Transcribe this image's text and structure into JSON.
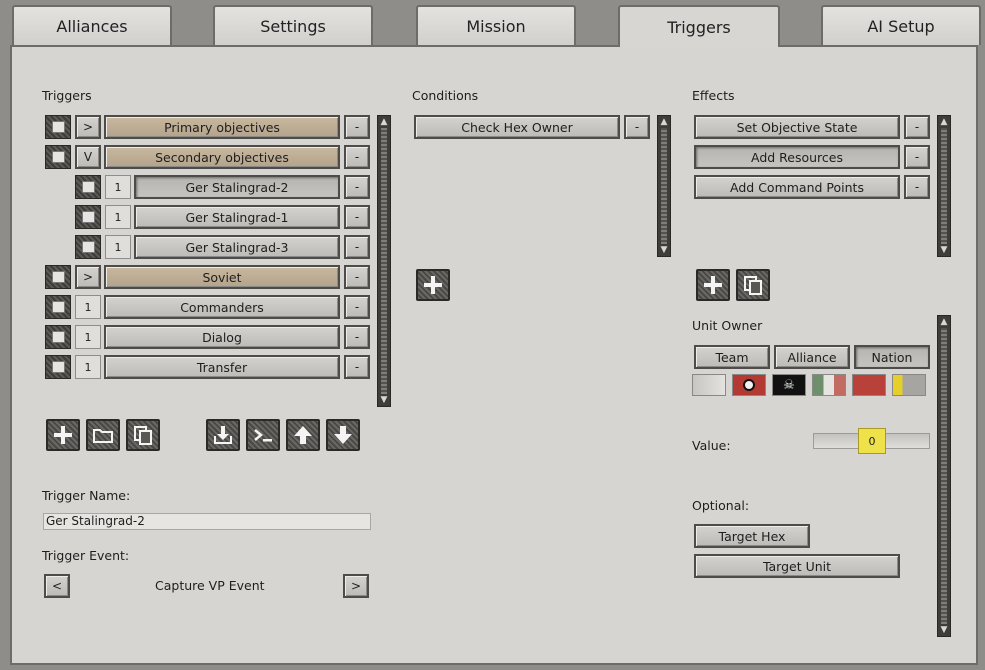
{
  "tabs": [
    {
      "label": "Alliances"
    },
    {
      "label": "Settings"
    },
    {
      "label": "Mission"
    },
    {
      "label": "Triggers"
    },
    {
      "label": "AI Setup"
    }
  ],
  "active_tab": "Triggers",
  "triggers": {
    "heading": "Triggers",
    "items": [
      {
        "toggle": ">",
        "label": "Primary objectives"
      },
      {
        "toggle": "V",
        "label": "Secondary objectives"
      },
      {
        "toggle": "1",
        "label": "Ger Stalingrad-2"
      },
      {
        "toggle": "1",
        "label": "Ger Stalingrad-1"
      },
      {
        "toggle": "1",
        "label": "Ger Stalingrad-3"
      },
      {
        "toggle": ">",
        "label": "Soviet"
      },
      {
        "toggle": "1",
        "label": "Commanders"
      },
      {
        "toggle": "1",
        "label": "Dialog"
      },
      {
        "toggle": "1",
        "label": "Transfer"
      }
    ],
    "remove_label": "-"
  },
  "trigger_name": {
    "label": "Trigger Name:",
    "value": "Ger Stalingrad-2"
  },
  "trigger_event": {
    "label": "Trigger Event:",
    "prev": "<",
    "value": "Capture VP Event",
    "next": ">"
  },
  "conditions": {
    "heading": "Conditions",
    "items": [
      {
        "label": "Check Hex Owner"
      }
    ],
    "remove_label": "-"
  },
  "effects": {
    "heading": "Effects",
    "items": [
      {
        "label": "Set Objective State"
      },
      {
        "label": "Add Resources"
      },
      {
        "label": "Add Command Points"
      }
    ],
    "remove_label": "-"
  },
  "unit_owner": {
    "label": "Unit Owner",
    "modes": [
      "Team",
      "Alliance",
      "Nation"
    ],
    "selected_mode": "Nation"
  },
  "value": {
    "label": "Value:",
    "amount": "0"
  },
  "optional": {
    "label": "Optional:",
    "target_hex": "Target Hex",
    "target_unit": "Target Unit"
  },
  "icons": {
    "add": "plus-icon",
    "folder": "folder-icon",
    "copy": "copy-icon",
    "import": "import-icon",
    "console": "console-icon",
    "up": "arrow-up-icon",
    "down": "arrow-down-icon"
  },
  "colors": {
    "panel": "#d7d5d2",
    "group_button": "#c9b8a0",
    "value_highlight": "#efe14a"
  }
}
